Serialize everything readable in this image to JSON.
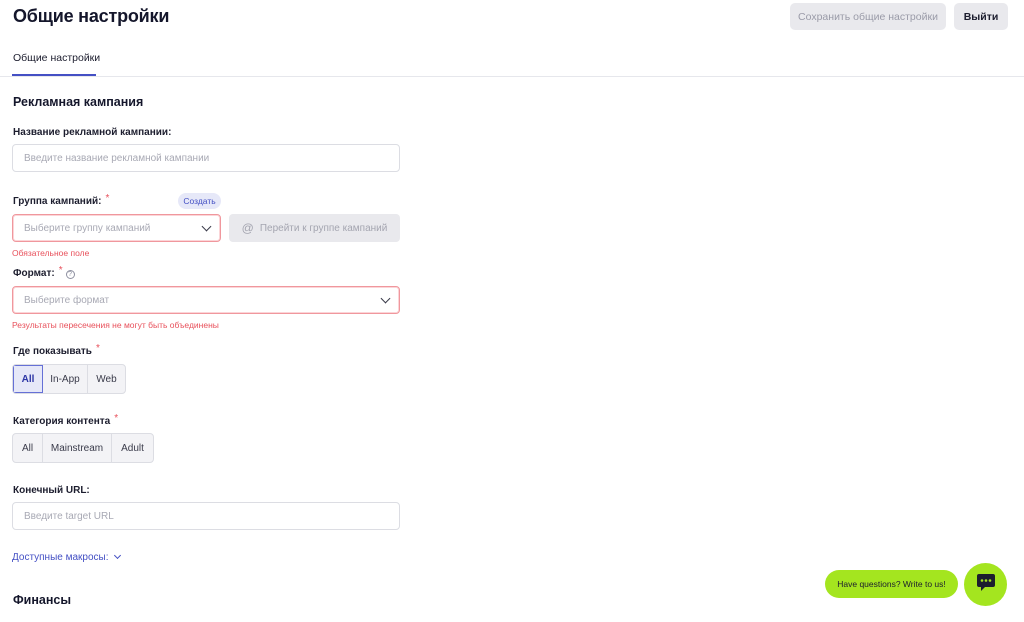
{
  "header": {
    "title": "Общие настройки",
    "save_label": "Сохранить общие настройки",
    "logout_label": "Выйти"
  },
  "tabs": [
    {
      "label": "Общие настройки",
      "active": true
    }
  ],
  "campaign": {
    "section_title": "Рекламная кампания",
    "name_label": "Название рекламной кампании:",
    "name_placeholder": "Введите название рекламной кампании",
    "group_label": "Группа кампаний:",
    "required_mark": "*",
    "create_label": "Создать",
    "group_placeholder": "Выберите группу кампаний",
    "goto_group_label": "Перейти к группе кампаний",
    "group_error": "Обязательное поле",
    "format_label": "Формат:",
    "help_icon": "?",
    "format_placeholder": "Выберите формат",
    "format_error": "Результаты пересечения не могут быть объединены",
    "where_label": "Где показывать",
    "where_options": [
      "All",
      "In-App",
      "Web"
    ],
    "where_selected": "All",
    "category_label": "Категория контента",
    "category_options": [
      "All",
      "Mainstream",
      "Adult"
    ],
    "url_label": "Конечный URL:",
    "url_placeholder": "Введите target URL",
    "macros_label": "Доступные макросы:"
  },
  "finance": {
    "section_title": "Финансы"
  },
  "chat": {
    "bubble_text": "Have questions? Write to us!",
    "icon": "chat-icon"
  },
  "colors": {
    "accent": "#4450c4",
    "error": "#e8505b",
    "chat": "#a4e51f"
  }
}
